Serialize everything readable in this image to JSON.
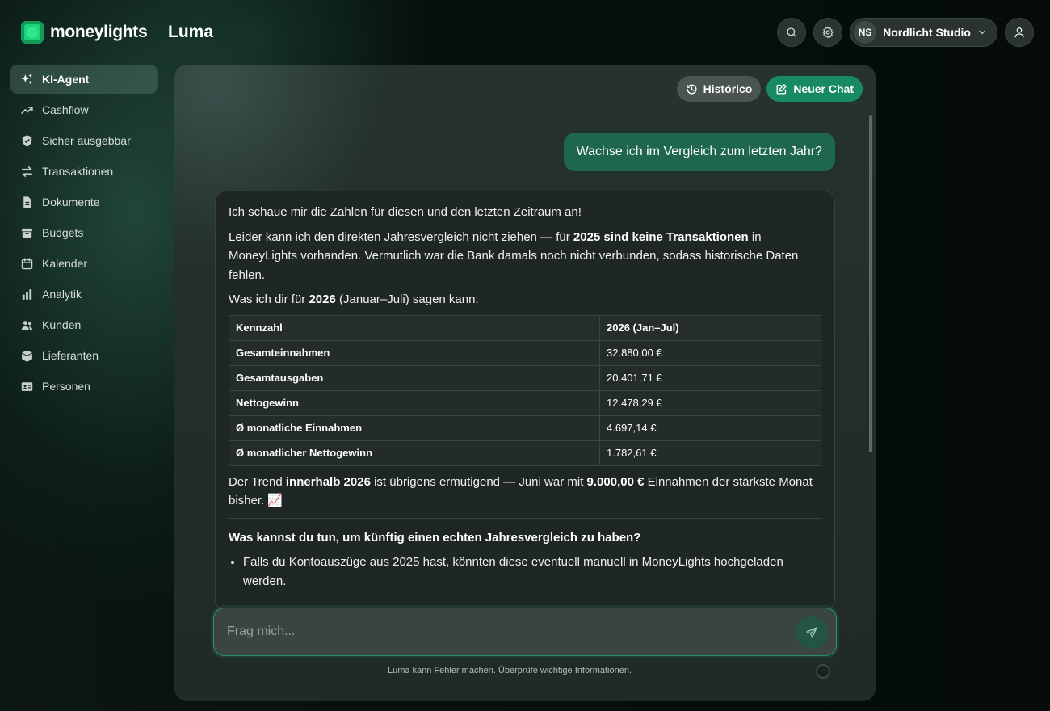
{
  "brand": {
    "name": "moneylights"
  },
  "app": {
    "title": "Luma"
  },
  "header": {
    "org_initials": "NS",
    "org_name": "Nordlicht Studio",
    "icons": [
      "search-icon",
      "gear-icon",
      "chevron-down-icon",
      "user-icon"
    ]
  },
  "sidebar": {
    "items": [
      {
        "label": "KI-Agent",
        "icon": "sparkles-icon",
        "active": true
      },
      {
        "label": "Cashflow",
        "icon": "trend-up-icon",
        "active": false
      },
      {
        "label": "Sicher ausgebbar",
        "icon": "shield-check-icon",
        "active": false
      },
      {
        "label": "Transaktionen",
        "icon": "arrows-swap-icon",
        "active": false
      },
      {
        "label": "Dokumente",
        "icon": "document-icon",
        "active": false
      },
      {
        "label": "Budgets",
        "icon": "archive-box-icon",
        "active": false
      },
      {
        "label": "Kalender",
        "icon": "calendar-icon",
        "active": false
      },
      {
        "label": "Analytik",
        "icon": "bar-chart-icon",
        "active": false
      },
      {
        "label": "Kunden",
        "icon": "users-icon",
        "active": false
      },
      {
        "label": "Lieferanten",
        "icon": "cube-icon",
        "active": false
      },
      {
        "label": "Personen",
        "icon": "id-card-icon",
        "active": false
      }
    ]
  },
  "chat": {
    "history_label": "Histórico",
    "new_chat_label": "Neuer Chat",
    "user_message": "Wachse ich im Vergleich zum letzten Jahr?",
    "answer": {
      "intro": "Ich schaue mir die Zahlen für diesen und den letzten Zeitraum an!",
      "p1_a": "Leider kann ich den direkten Jahresvergleich nicht ziehen — für ",
      "p1_b": "2025 sind keine Transaktionen",
      "p1_c": " in MoneyLights vorhanden. Vermutlich war die Bank damals noch nicht verbunden, sodass historische Daten fehlen.",
      "p2_a": "Was ich dir für ",
      "p2_b": "2026",
      "p2_c": " (Januar–Juli) sagen kann:",
      "table": {
        "headers": [
          "Kennzahl",
          "2026 (Jan–Jul)"
        ],
        "rows": [
          [
            "Gesamteinnahmen",
            "32.880,00 €"
          ],
          [
            "Gesamtausgaben",
            "20.401,71 €"
          ],
          [
            "Nettogewinn",
            "12.478,29 €"
          ],
          [
            "Ø monatliche Einnahmen",
            "4.697,14 €"
          ],
          [
            "Ø monatlicher Nettogewinn",
            "1.782,61 €"
          ]
        ]
      },
      "p3_a": "Der Trend ",
      "p3_b": "innerhalb 2026",
      "p3_c": " ist übrigens ermutigend — Juni war mit ",
      "p3_d": "9.000,00 €",
      "p3_e": " Einnahmen der stärkste Monat bisher. 📈",
      "heading": "Was kannst du tun, um künftig einen echten Jahresvergleich zu haben?",
      "bullets": [
        "Falls du Kontoauszüge aus 2025 hast, könnten diese eventuell manuell in MoneyLights hochgeladen werden."
      ]
    },
    "input_placeholder": "Frag mich...",
    "disclaimer": "Luma kann Fehler machen. Überprüfe wichtige Informationen."
  },
  "colors": {
    "accent": "#178a62",
    "user_bubble": "#1e6650",
    "brand_green": "#1fd27d"
  }
}
